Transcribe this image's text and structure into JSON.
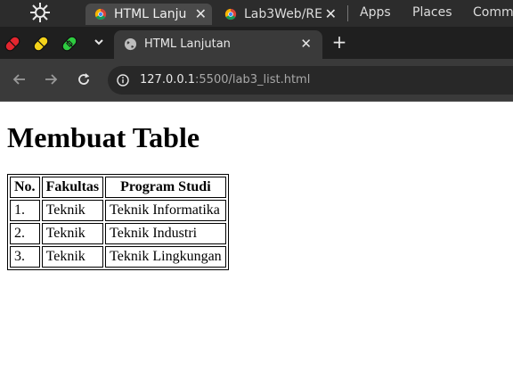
{
  "system_bar": {
    "tabs": [
      {
        "label": "HTML Lanju",
        "icon": "chrome-icon",
        "active": true
      },
      {
        "label": "Lab3Web/RE",
        "icon": "chrome-icon",
        "active": false
      }
    ],
    "menus": [
      "Apps",
      "Places",
      "Comm"
    ],
    "close_glyph": "✕"
  },
  "browser": {
    "active_tab": {
      "label": "HTML Lanjutan",
      "icon": "globe-icon",
      "close_glyph": "✕"
    },
    "new_tab_glyph": "+",
    "address": {
      "host": "127.0.0.1",
      "rest": ":5500/lab3_list.html"
    }
  },
  "page": {
    "title": "Membuat Table",
    "table": {
      "headers": [
        "No.",
        "Fakultas",
        "Program Studi"
      ],
      "rows": [
        [
          "1.",
          "Teknik",
          "Teknik Informatika"
        ],
        [
          "2.",
          "Teknik",
          "Teknik Industri"
        ],
        [
          "3.",
          "Teknik",
          "Teknik Lingkungan"
        ]
      ]
    }
  },
  "colors": {
    "system_bar_bg": "#2c2c2c",
    "tab_strip_bg": "#1f1f1f",
    "toolbar_bg": "#3a3a3a",
    "omnibox_bg": "#282828",
    "extension_red": "#e3262f",
    "extension_yellow": "#f4d31a",
    "extension_green": "#2ecc40"
  }
}
